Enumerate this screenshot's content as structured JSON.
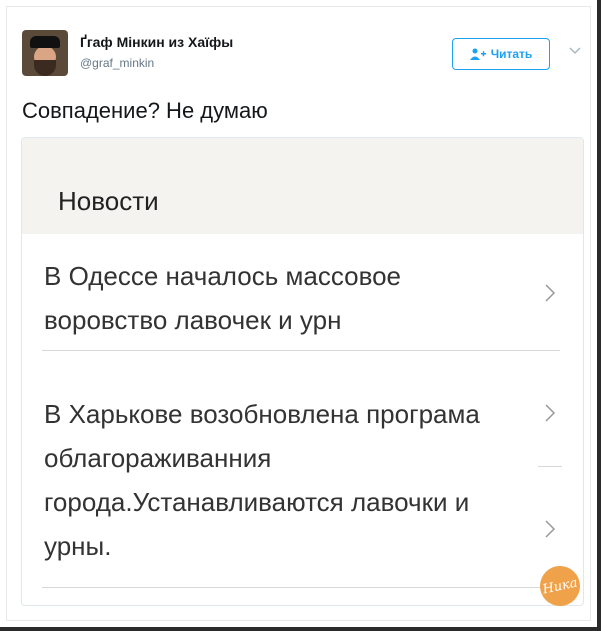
{
  "tweet": {
    "author_name": "Ґгаф Мінкин из Хаїфы",
    "handle": "@graf_minkin",
    "follow_label": "Читать",
    "text": "Совпадение? Не думаю"
  },
  "card": {
    "title": "Новости",
    "items": [
      {
        "text": "В Одессе началось массовое воровство лавочек и урн"
      },
      {
        "text": "В Харькове возобновлена програма облагораживанния города.Устанавливаются лавочки и урны."
      }
    ]
  },
  "watermark": {
    "label": "Ника"
  },
  "colors": {
    "accent": "#1da1f2",
    "card_header_bg": "#f5f3ef",
    "watermark_bg": "#f0a24a"
  }
}
